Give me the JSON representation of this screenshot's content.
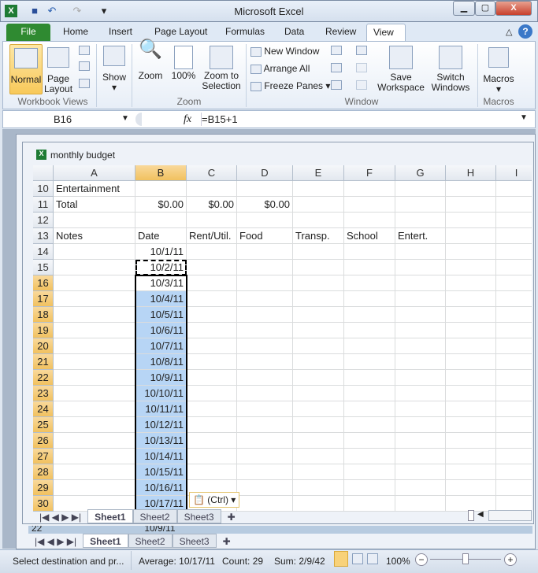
{
  "app": {
    "title": "Microsoft Excel"
  },
  "qat": {
    "undo": "↶",
    "redo": "↷"
  },
  "tabs": [
    "File",
    "Home",
    "Insert",
    "Page Layout",
    "Formulas",
    "Data",
    "Review",
    "View"
  ],
  "ribbon": {
    "workbook_views": {
      "label": "Workbook Views",
      "normal": "Normal",
      "page_layout": [
        "Page",
        "Layout"
      ]
    },
    "show": "Show",
    "zoom": {
      "label": "Zoom",
      "zoom": "Zoom",
      "pct": "100%",
      "zoom_to": [
        "Zoom to",
        "Selection"
      ]
    },
    "window": {
      "label": "Window",
      "new_window": "New Window",
      "arrange_all": "Arrange All",
      "freeze_panes": "Freeze Panes",
      "save": [
        "Save",
        "Workspace"
      ],
      "switch": [
        "Switch",
        "Windows"
      ]
    },
    "macros": {
      "label": "Macros",
      "macros": "Macros"
    }
  },
  "formula_bar": {
    "name_box": "B16",
    "fx": "fx",
    "formula": "=B15+1"
  },
  "workbook": {
    "title": "monthly budget"
  },
  "columns": [
    "A",
    "B",
    "C",
    "D",
    "E",
    "F",
    "G",
    "H",
    "I"
  ],
  "rows": [
    {
      "n": "10",
      "cells": [
        "Entertainment",
        "",
        "",
        "",
        "",
        "",
        "",
        "",
        ""
      ]
    },
    {
      "n": "11",
      "cells": [
        "Total",
        "$0.00",
        "$0.00",
        "$0.00",
        "",
        "",
        "",
        "",
        ""
      ]
    },
    {
      "n": "12",
      "cells": [
        "",
        "",
        "",
        "",
        "",
        "",
        "",
        "",
        ""
      ]
    },
    {
      "n": "13",
      "cells": [
        "Notes",
        "Date",
        "Rent/Util.",
        "Food",
        "Transp.",
        "School",
        "Entert.",
        "",
        ""
      ]
    },
    {
      "n": "14",
      "cells": [
        "",
        "10/1/11",
        "",
        "",
        "",
        "",
        "",
        "",
        ""
      ]
    },
    {
      "n": "15",
      "cells": [
        "",
        "10/2/11",
        "",
        "",
        "",
        "",
        "",
        "",
        ""
      ]
    },
    {
      "n": "16",
      "cells": [
        "",
        "10/3/11",
        "",
        "",
        "",
        "",
        "",
        "",
        ""
      ]
    },
    {
      "n": "17",
      "cells": [
        "",
        "10/4/11",
        "",
        "",
        "",
        "",
        "",
        "",
        ""
      ]
    },
    {
      "n": "18",
      "cells": [
        "",
        "10/5/11",
        "",
        "",
        "",
        "",
        "",
        "",
        ""
      ]
    },
    {
      "n": "19",
      "cells": [
        "",
        "10/6/11",
        "",
        "",
        "",
        "",
        "",
        "",
        ""
      ]
    },
    {
      "n": "20",
      "cells": [
        "",
        "10/7/11",
        "",
        "",
        "",
        "",
        "",
        "",
        ""
      ]
    },
    {
      "n": "21",
      "cells": [
        "",
        "10/8/11",
        "",
        "",
        "",
        "",
        "",
        "",
        ""
      ]
    },
    {
      "n": "22",
      "cells": [
        "",
        "10/9/11",
        "",
        "",
        "",
        "",
        "",
        "",
        ""
      ]
    },
    {
      "n": "23",
      "cells": [
        "",
        "10/10/11",
        "",
        "",
        "",
        "",
        "",
        "",
        ""
      ]
    },
    {
      "n": "24",
      "cells": [
        "",
        "10/11/11",
        "",
        "",
        "",
        "",
        "",
        "",
        ""
      ]
    },
    {
      "n": "25",
      "cells": [
        "",
        "10/12/11",
        "",
        "",
        "",
        "",
        "",
        "",
        ""
      ]
    },
    {
      "n": "26",
      "cells": [
        "",
        "10/13/11",
        "",
        "",
        "",
        "",
        "",
        "",
        ""
      ]
    },
    {
      "n": "27",
      "cells": [
        "",
        "10/14/11",
        "",
        "",
        "",
        "",
        "",
        "",
        ""
      ]
    },
    {
      "n": "28",
      "cells": [
        "",
        "10/15/11",
        "",
        "",
        "",
        "",
        "",
        "",
        ""
      ]
    },
    {
      "n": "29",
      "cells": [
        "",
        "10/16/11",
        "",
        "",
        "",
        "",
        "",
        "",
        ""
      ]
    },
    {
      "n": "30",
      "cells": [
        "",
        "10/17/11",
        "",
        "",
        "",
        "",
        "",
        "",
        ""
      ]
    }
  ],
  "paste_options": "(Ctrl)",
  "sheets": [
    "Sheet1",
    "Sheet2",
    "Sheet3"
  ],
  "back_window": {
    "row": "22",
    "value": "10/9/11"
  },
  "status": {
    "message": "Select destination and pr...",
    "average": "Average: 10/17/11",
    "count": "Count: 29",
    "sum": "Sum: 2/9/42",
    "zoom": "100%"
  },
  "colors": {
    "selection": "#b7d5f5",
    "header_selected": "#f1c15f",
    "file_tab": "#2f8a31"
  }
}
